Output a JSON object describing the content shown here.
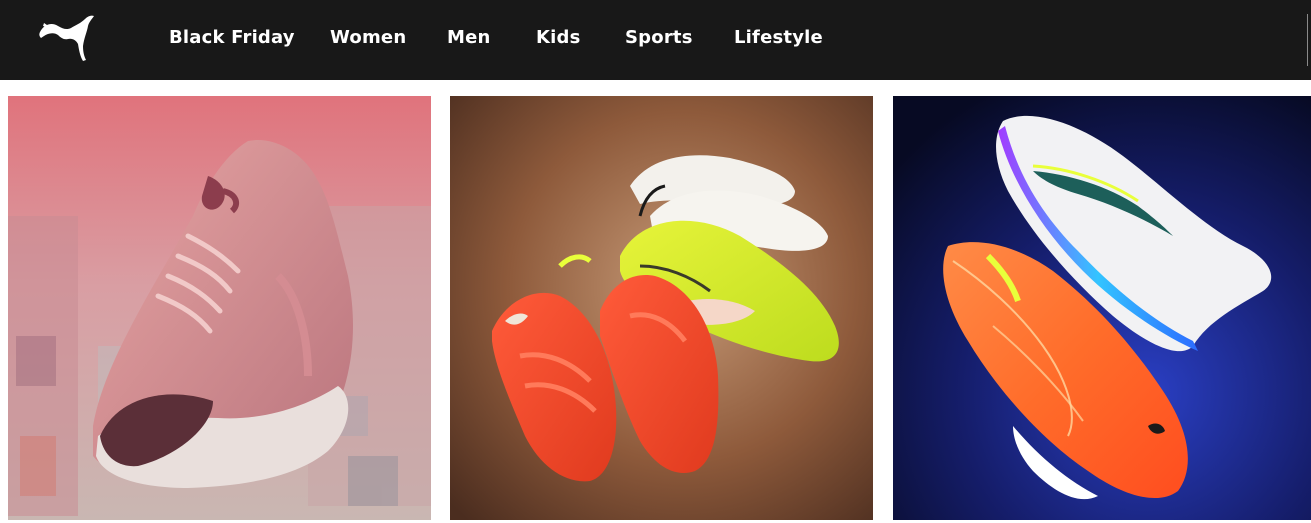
{
  "nav": {
    "logo": "puma-cat-logo",
    "items": [
      {
        "label": "Black Friday"
      },
      {
        "label": "Women"
      },
      {
        "label": "Men"
      },
      {
        "label": "Kids"
      },
      {
        "label": "Sports"
      },
      {
        "label": "Lifestyle"
      }
    ]
  },
  "tiles": [
    {
      "icon": "pink-running-shoe-image"
    },
    {
      "icon": "football-boots-image"
    },
    {
      "icon": "indoor-court-shoes-image"
    }
  ],
  "colors": {
    "navbar": "#181818",
    "nav_text": "#ffffff"
  }
}
